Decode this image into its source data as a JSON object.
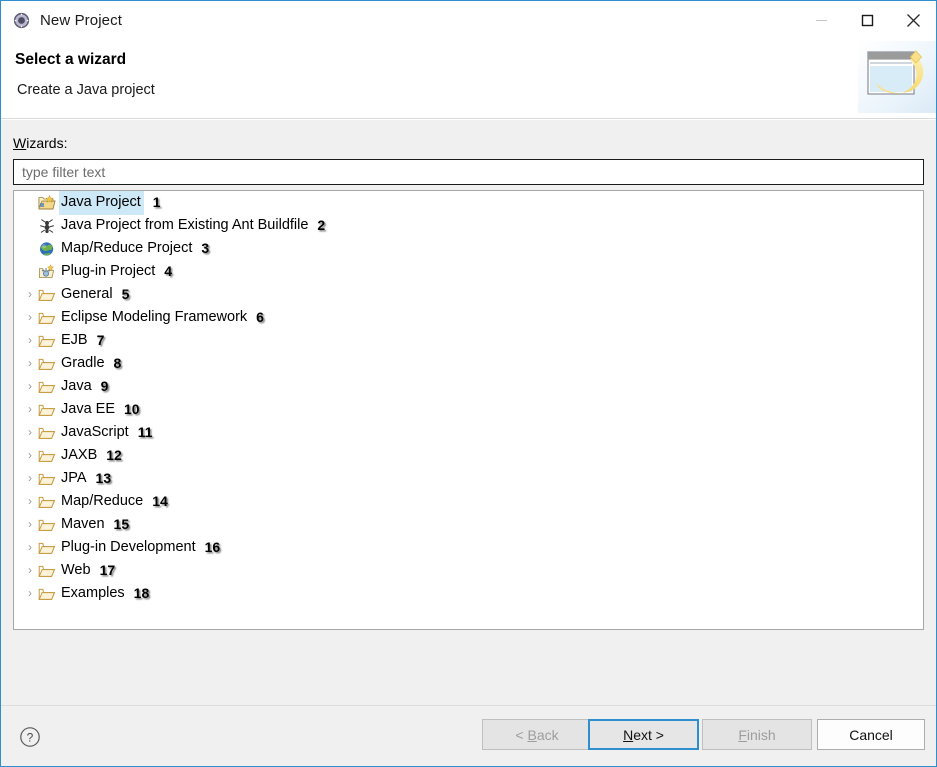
{
  "window": {
    "title": "New Project",
    "icon": "eclipse-ring-icon",
    "border_color": "#2f8fce",
    "controls": [
      {
        "name": "minimize-button",
        "glyph": "minimize-icon"
      },
      {
        "name": "maximize-button",
        "glyph": "maximize-icon"
      },
      {
        "name": "close-button",
        "glyph": "close-icon"
      }
    ]
  },
  "header": {
    "title": "Select a wizard",
    "subtitle": "Create a Java project",
    "banner_icon": "new-project-banner-icon"
  },
  "body": {
    "wizards_label_mnemonic": "W",
    "wizards_label_rest": "izards:",
    "filter": {
      "placeholder": "type filter text",
      "value": ""
    },
    "selection_color": "#cde8f6",
    "tree": [
      {
        "label": "Java Project",
        "number": "1",
        "icon": "java-project-icon",
        "expandable": false,
        "selected": true
      },
      {
        "label": "Java Project from Existing Ant Buildfile",
        "number": "2",
        "icon": "ant-buildfile-icon",
        "expandable": false,
        "selected": false
      },
      {
        "label": "Map/Reduce Project",
        "number": "3",
        "icon": "mapreduce-globe-icon",
        "expandable": false,
        "selected": false
      },
      {
        "label": "Plug-in Project",
        "number": "4",
        "icon": "plugin-project-icon",
        "expandable": false,
        "selected": false
      },
      {
        "label": "General",
        "number": "5",
        "icon": "folder-icon",
        "expandable": true,
        "selected": false
      },
      {
        "label": "Eclipse Modeling Framework",
        "number": "6",
        "icon": "folder-icon",
        "expandable": true,
        "selected": false
      },
      {
        "label": "EJB",
        "number": "7",
        "icon": "folder-icon",
        "expandable": true,
        "selected": false
      },
      {
        "label": "Gradle",
        "number": "8",
        "icon": "folder-icon",
        "expandable": true,
        "selected": false
      },
      {
        "label": "Java",
        "number": "9",
        "icon": "folder-icon",
        "expandable": true,
        "selected": false
      },
      {
        "label": "Java EE",
        "number": "10",
        "icon": "folder-icon",
        "expandable": true,
        "selected": false
      },
      {
        "label": "JavaScript",
        "number": "11",
        "icon": "folder-icon",
        "expandable": true,
        "selected": false
      },
      {
        "label": "JAXB",
        "number": "12",
        "icon": "folder-icon",
        "expandable": true,
        "selected": false
      },
      {
        "label": "JPA",
        "number": "13",
        "icon": "folder-icon",
        "expandable": true,
        "selected": false
      },
      {
        "label": "Map/Reduce",
        "number": "14",
        "icon": "folder-icon",
        "expandable": true,
        "selected": false
      },
      {
        "label": "Maven",
        "number": "15",
        "icon": "folder-icon",
        "expandable": true,
        "selected": false
      },
      {
        "label": "Plug-in Development",
        "number": "16",
        "icon": "folder-icon",
        "expandable": true,
        "selected": false
      },
      {
        "label": "Web",
        "number": "17",
        "icon": "folder-icon",
        "expandable": true,
        "selected": false
      },
      {
        "label": "Examples",
        "number": "18",
        "icon": "folder-icon",
        "expandable": true,
        "selected": false
      }
    ]
  },
  "footer": {
    "help_icon": "help-question-icon",
    "buttons": {
      "back": {
        "label": "< Back",
        "mnemonic": "B",
        "enabled": false,
        "default": false
      },
      "next": {
        "label": "Next >",
        "mnemonic": "N",
        "enabled": true,
        "default": true
      },
      "finish": {
        "label": "Finish",
        "mnemonic": "F",
        "enabled": false,
        "default": false
      },
      "cancel": {
        "label": "Cancel",
        "mnemonic": "",
        "enabled": true,
        "default": false
      }
    }
  }
}
